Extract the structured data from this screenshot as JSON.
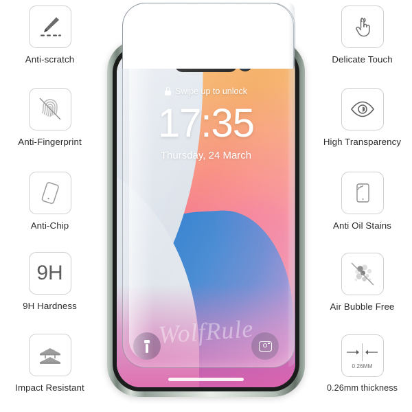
{
  "product": {
    "watermark": "WolfRule"
  },
  "features_left": [
    {
      "label": "Anti-scratch",
      "icon": "knife-scratch-icon"
    },
    {
      "label": "Anti-Fingerprint",
      "icon": "fingerprint-crossed-icon"
    },
    {
      "label": "Anti-Chip",
      "icon": "phone-tilted-icon"
    },
    {
      "label": "9H Hardness",
      "icon": "9h-hardness-icon",
      "icon_text": "9H"
    },
    {
      "label": "Impact Resistant",
      "icon": "impact-layers-icon"
    }
  ],
  "features_right": [
    {
      "label": "Delicate Touch",
      "icon": "hand-tap-icon"
    },
    {
      "label": "High Transparency",
      "icon": "eye-icon"
    },
    {
      "label": "Anti Oil Stains",
      "icon": "phone-oil-splash-icon"
    },
    {
      "label": "Air Bubble Free",
      "icon": "bubbles-crossed-icon"
    },
    {
      "label": "0.26mm thickness",
      "icon": "thickness-caliper-icon",
      "icon_text": "0.26MM"
    }
  ],
  "phone": {
    "lock_hint": "Swipe up to unlock",
    "time": "17:35",
    "date": "Thursday, 24 March",
    "status": {
      "wifi": "wifi-icon",
      "battery": "battery-icon"
    },
    "quick_actions": {
      "flashlight": "flashlight-icon",
      "camera": "camera-icon"
    }
  },
  "colors": {
    "icon_border": "#cfcfcf",
    "icon_glyph": "#6b6b6b",
    "label_text": "#2b2b2b",
    "phone_frame": "#b0bcb3"
  }
}
